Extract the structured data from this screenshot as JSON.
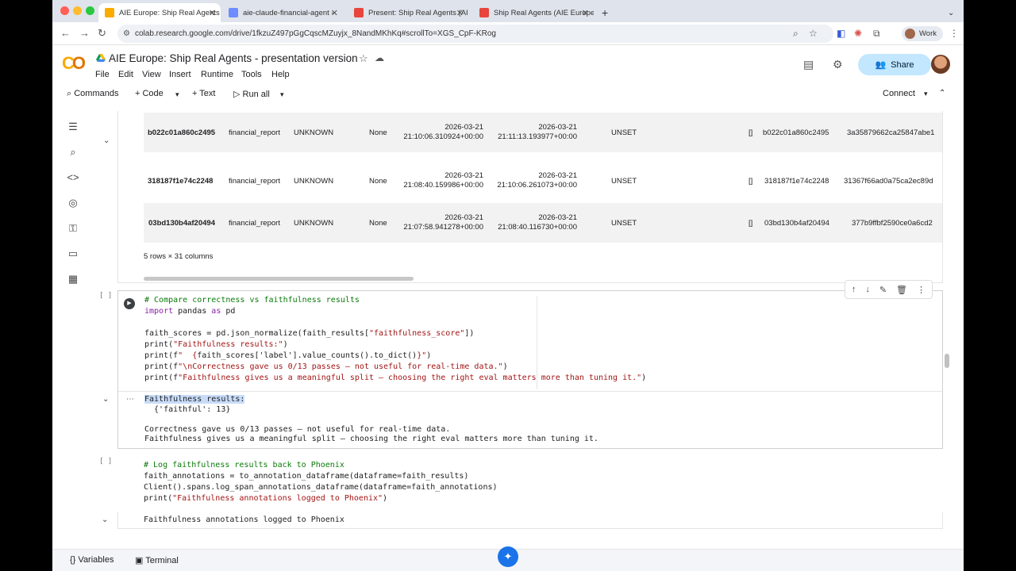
{
  "browser": {
    "tabs": [
      {
        "title": "AIE Europe: Ship Real Agents",
        "active": true,
        "favicon": "colab"
      },
      {
        "title": "aie-claude-financial-agent - ",
        "active": false,
        "favicon": "arize"
      },
      {
        "title": "Present: Ship Real Agents (AI",
        "active": false,
        "favicon": "slides"
      },
      {
        "title": "Ship Real Agents (AIE Europe",
        "active": false,
        "favicon": "slides"
      }
    ],
    "url": "colab.research.google.com/drive/1fkzuZ497pGgCqscMZuyjx_8NandMKhKq#scrollTo=XGS_CpF-KRog",
    "profile_label": "Work"
  },
  "colab": {
    "notebook_title": "AIE Europe: Ship Real Agents - presentation version",
    "menu": [
      "File",
      "Edit",
      "View",
      "Insert",
      "Runtime",
      "Tools",
      "Help"
    ],
    "share_label": "Share",
    "toolbar": {
      "commands": "Commands",
      "code": "Code",
      "text": "Text",
      "run_all": "Run all",
      "connect": "Connect"
    }
  },
  "table": {
    "rows": [
      {
        "id": "b022c01a860c2495",
        "name": "financial_report",
        "kind": "UNKNOWN",
        "parent": "None",
        "start_date": "2026-03-21",
        "start_time": "21:10:06.310924+00:00",
        "end_date": "2026-03-21",
        "end_time": "21:11:13.193977+00:00",
        "status": "UNSET",
        "events": "[]",
        "span_id": "b022c01a860c2495",
        "trace_id": "3a35879662ca25847abe1"
      },
      {
        "id": "318187f1e74c2248",
        "name": "financial_report",
        "kind": "UNKNOWN",
        "parent": "None",
        "start_date": "2026-03-21",
        "start_time": "21:08:40.159986+00:00",
        "end_date": "2026-03-21",
        "end_time": "21:10:06.261073+00:00",
        "status": "UNSET",
        "events": "[]",
        "span_id": "318187f1e74c2248",
        "trace_id": "31367f66ad0a75ca2ec89d"
      },
      {
        "id": "03bd130b4af20494",
        "name": "financial_report",
        "kind": "UNKNOWN",
        "parent": "None",
        "start_date": "2026-03-21",
        "start_time": "21:07:58.941278+00:00",
        "end_date": "2026-03-21",
        "end_time": "21:08:40.116730+00:00",
        "status": "UNSET",
        "events": "[]",
        "span_id": "03bd130b4af20494",
        "trace_id": "377b9ffbf2590ce0a6cd2"
      }
    ],
    "shape": "5 rows × 31 columns"
  },
  "cell1": {
    "bracket": "[ ]",
    "code": {
      "l1": "# Compare correctness vs faithfulness results",
      "l2_kw": "import",
      "l2_rest": " pandas ",
      "l2_as": "as",
      "l2_end": " pd",
      "l4_a": "faith_scores = pd.json_normalize(faith_results[",
      "l4_s": "\"faithfulness_score\"",
      "l4_b": "])",
      "l5_a": "print(",
      "l5_s": "\"Faithfulness results:\"",
      "l5_b": ")",
      "l6_a": "print(f",
      "l6_s1": "\"  {",
      "l6_m": "faith_scores['label'].value_counts().to_dict()",
      "l6_s2": "}\"",
      "l6_b": ")",
      "l7_a": "print(f",
      "l7_s": "\"\\nCorrectness gave us 0/13 passes — not useful for real-time data.\"",
      "l7_b": ")",
      "l8_a": "print(f",
      "l8_s": "\"Faithfulness gives us a meaningful split — choosing the right eval matters more than tuning it.\"",
      "l8_b": ")"
    },
    "output": {
      "l1": "Faithfulness results:",
      "l2": "  {'faithful': 13}",
      "l3": "Correctness gave us 0/13 passes — not useful for real-time data.",
      "l4": "Faithfulness gives us a meaningful split — choosing the right eval matters more than tuning it."
    }
  },
  "cell2": {
    "bracket": "[ ]",
    "code": {
      "l1": "# Log faithfulness results back to Phoenix",
      "l2": "faith_annotations = to_annotation_dataframe(dataframe=faith_results)",
      "l3": "Client().spans.log_span_annotations_dataframe(dataframe=faith_annotations)",
      "l4_a": "print(",
      "l4_s": "\"Faithfulness annotations logged to Phoenix\"",
      "l4_b": ")"
    },
    "output": "Faithfulness annotations logged to Phoenix"
  },
  "statusbar": {
    "variables": "Variables",
    "terminal": "Terminal"
  }
}
